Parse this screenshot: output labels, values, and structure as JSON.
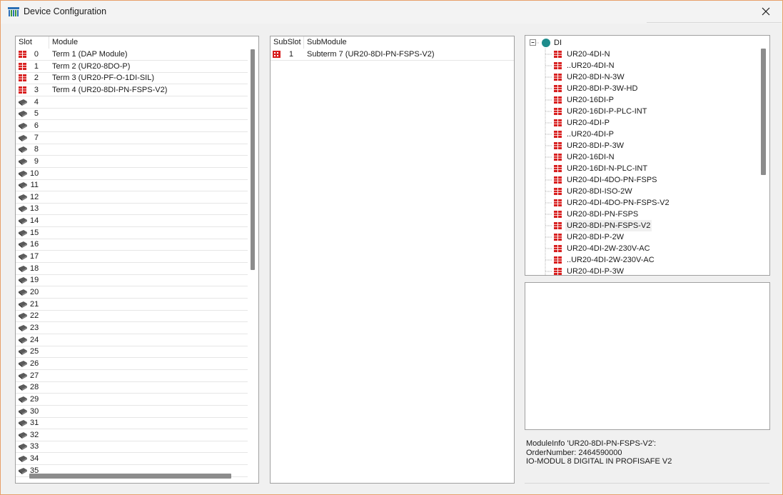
{
  "window": {
    "title": "Device Configuration",
    "colors": {
      "accent_border": "#e8a06a",
      "module_red": "#d81f1f",
      "tree_root": "#1e8c8c"
    }
  },
  "slots_panel": {
    "headers": {
      "slot": "Slot",
      "module": "Module"
    },
    "rows": [
      {
        "slot": "0",
        "module": "Term 1 (DAP Module)",
        "icon": "red-module-icon"
      },
      {
        "slot": "1",
        "module": "Term 2 (UR20-8DO-P)",
        "icon": "red-module-icon"
      },
      {
        "slot": "2",
        "module": "Term 3 (UR20-PF-O-1DI-SIL)",
        "icon": "red-module-icon"
      },
      {
        "slot": "3",
        "module": "Term 4 (UR20-8DI-PN-FSPS-V2)",
        "icon": "red-module-icon"
      },
      {
        "slot": "4",
        "module": "",
        "icon": "empty-slot-icon"
      },
      {
        "slot": "5",
        "module": "",
        "icon": "empty-slot-icon"
      },
      {
        "slot": "6",
        "module": "",
        "icon": "empty-slot-icon"
      },
      {
        "slot": "7",
        "module": "",
        "icon": "empty-slot-icon"
      },
      {
        "slot": "8",
        "module": "",
        "icon": "empty-slot-icon"
      },
      {
        "slot": "9",
        "module": "",
        "icon": "empty-slot-icon"
      },
      {
        "slot": "10",
        "module": "",
        "icon": "empty-slot-icon"
      },
      {
        "slot": "11",
        "module": "",
        "icon": "empty-slot-icon"
      },
      {
        "slot": "12",
        "module": "",
        "icon": "empty-slot-icon"
      },
      {
        "slot": "13",
        "module": "",
        "icon": "empty-slot-icon"
      },
      {
        "slot": "14",
        "module": "",
        "icon": "empty-slot-icon"
      },
      {
        "slot": "15",
        "module": "",
        "icon": "empty-slot-icon"
      },
      {
        "slot": "16",
        "module": "",
        "icon": "empty-slot-icon"
      },
      {
        "slot": "17",
        "module": "",
        "icon": "empty-slot-icon"
      },
      {
        "slot": "18",
        "module": "",
        "icon": "empty-slot-icon"
      },
      {
        "slot": "19",
        "module": "",
        "icon": "empty-slot-icon"
      },
      {
        "slot": "20",
        "module": "",
        "icon": "empty-slot-icon"
      },
      {
        "slot": "21",
        "module": "",
        "icon": "empty-slot-icon"
      },
      {
        "slot": "22",
        "module": "",
        "icon": "empty-slot-icon"
      },
      {
        "slot": "23",
        "module": "",
        "icon": "empty-slot-icon"
      },
      {
        "slot": "24",
        "module": "",
        "icon": "empty-slot-icon"
      },
      {
        "slot": "25",
        "module": "",
        "icon": "empty-slot-icon"
      },
      {
        "slot": "26",
        "module": "",
        "icon": "empty-slot-icon"
      },
      {
        "slot": "27",
        "module": "",
        "icon": "empty-slot-icon"
      },
      {
        "slot": "28",
        "module": "",
        "icon": "empty-slot-icon"
      },
      {
        "slot": "29",
        "module": "",
        "icon": "empty-slot-icon"
      },
      {
        "slot": "30",
        "module": "",
        "icon": "empty-slot-icon"
      },
      {
        "slot": "31",
        "module": "",
        "icon": "empty-slot-icon"
      },
      {
        "slot": "32",
        "module": "",
        "icon": "empty-slot-icon"
      },
      {
        "slot": "33",
        "module": "",
        "icon": "empty-slot-icon"
      },
      {
        "slot": "34",
        "module": "",
        "icon": "empty-slot-icon"
      },
      {
        "slot": "35",
        "module": "",
        "icon": "empty-slot-icon"
      }
    ]
  },
  "subslots_panel": {
    "headers": {
      "subslot": "SubSlot",
      "submodule": "SubModule"
    },
    "rows": [
      {
        "subslot": "1",
        "submodule": "Subterm 7 (UR20-8DI-PN-FSPS-V2)",
        "icon": "red-submodule-icon"
      }
    ]
  },
  "catalog_tree": {
    "root_label": "DI",
    "items": [
      "UR20-4DI-N",
      "..UR20-4DI-N",
      "UR20-8DI-N-3W",
      "UR20-8DI-P-3W-HD",
      "UR20-16DI-P",
      "UR20-16DI-P-PLC-INT",
      "UR20-4DI-P",
      "..UR20-4DI-P",
      "UR20-8DI-P-3W",
      "UR20-16DI-N",
      "UR20-16DI-N-PLC-INT",
      "UR20-4DI-4DO-PN-FSPS",
      "UR20-8DI-ISO-2W",
      "UR20-4DI-4DO-PN-FSPS-V2",
      "UR20-8DI-PN-FSPS",
      "UR20-8DI-PN-FSPS-V2",
      "UR20-8DI-P-2W",
      "UR20-4DI-2W-230V-AC",
      "..UR20-4DI-2W-230V-AC",
      "UR20-4DI-P-3W"
    ],
    "selected_index": 15
  },
  "module_info": {
    "lines": [
      "ModuleInfo 'UR20-8DI-PN-FSPS-V2':",
      "OrderNumber: 2464590000",
      "IO-MODUL 8 DIGITAL IN PROFISAFE V2"
    ]
  }
}
